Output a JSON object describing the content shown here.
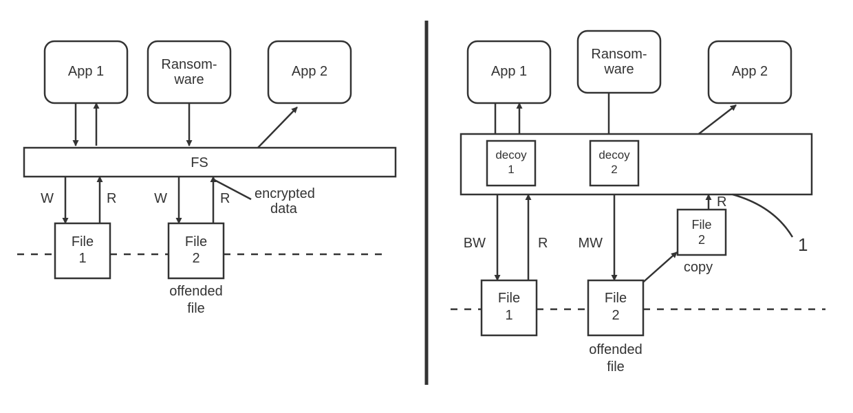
{
  "chart_data": {
    "type": "diagram",
    "title": "",
    "panels": [
      {
        "side": "left",
        "nodes": [
          {
            "id": "left-app1",
            "label": "App 1"
          },
          {
            "id": "left-ransomware",
            "label": "Ransom-\nware"
          },
          {
            "id": "left-app2",
            "label": "App 2"
          },
          {
            "id": "left-fs",
            "label": "FS"
          },
          {
            "id": "left-file1",
            "label": "File\n1"
          },
          {
            "id": "left-file2",
            "label": "File\n2"
          }
        ],
        "edges": [
          {
            "from": "left-app1",
            "to": "left-fs",
            "label": "",
            "dir": "both"
          },
          {
            "from": "left-ransomware",
            "to": "left-fs",
            "label": "",
            "dir": "one"
          },
          {
            "from": "left-fs",
            "to": "left-app2",
            "label": "",
            "dir": "one"
          },
          {
            "from": "left-fs",
            "to": "left-file1",
            "label": "W",
            "dir": "one"
          },
          {
            "from": "left-file1",
            "to": "left-fs",
            "label": "R",
            "dir": "one"
          },
          {
            "from": "left-fs",
            "to": "left-file2",
            "label": "W",
            "dir": "one"
          },
          {
            "from": "left-file2",
            "to": "left-fs",
            "label": "R",
            "dir": "one"
          }
        ],
        "annotations": [
          {
            "target": "left-file2",
            "text": "encrypted\ndata",
            "pos": "right"
          },
          {
            "target": "left-file2",
            "text": "offended\nfile",
            "pos": "below"
          }
        ]
      },
      {
        "side": "right",
        "nodes": [
          {
            "id": "right-app1",
            "label": "App 1"
          },
          {
            "id": "right-ransomware",
            "label": "Ransom-\nware"
          },
          {
            "id": "right-app2",
            "label": "App 2"
          },
          {
            "id": "right-fsbar",
            "label": ""
          },
          {
            "id": "right-decoy1",
            "label": "decoy\n1"
          },
          {
            "id": "right-decoy2",
            "label": "decoy\n2"
          },
          {
            "id": "right-file1",
            "label": "File\n1"
          },
          {
            "id": "right-file2",
            "label": "File\n2"
          },
          {
            "id": "right-file2copy",
            "label": "File\n2"
          }
        ],
        "edges": [
          {
            "from": "right-app1",
            "to": "right-decoy1",
            "label": "",
            "dir": "both"
          },
          {
            "from": "right-ransomware",
            "to": "right-decoy2",
            "label": "",
            "dir": "one"
          },
          {
            "from": "right-fsbar",
            "to": "right-app2",
            "label": "",
            "dir": "one"
          },
          {
            "from": "right-decoy1",
            "to": "right-file1",
            "label": "BW",
            "dir": "one"
          },
          {
            "from": "right-file1",
            "to": "right-decoy1",
            "label": "R",
            "dir": "one"
          },
          {
            "from": "right-decoy2",
            "to": "right-file2",
            "label": "MW",
            "dir": "one"
          },
          {
            "from": "right-file2copy",
            "to": "right-fsbar",
            "label": "R",
            "dir": "one"
          },
          {
            "from": "right-file2",
            "to": "right-file2copy",
            "label": "",
            "dir": "one"
          }
        ],
        "annotations": [
          {
            "target": "right-file2copy",
            "text": "copy",
            "pos": "below"
          },
          {
            "target": "right-file2",
            "text": "offended\nfile",
            "pos": "below"
          },
          {
            "target": "right-fsbar",
            "text": "1",
            "pos": "right-num"
          }
        ]
      }
    ]
  },
  "left": {
    "app1": "App 1",
    "ransom1": "Ransom-",
    "ransom2": "ware",
    "app2": "App 2",
    "fs": "FS",
    "file1a": "File",
    "file1b": "1",
    "file2a": "File",
    "file2b": "2",
    "W": "W",
    "R": "R",
    "enc1": "encrypted",
    "enc2": "data",
    "off1": "offended",
    "off2": "file"
  },
  "right": {
    "app1": "App 1",
    "ransom1": "Ransom-",
    "ransom2": "ware",
    "app2": "App 2",
    "decoy1a": "decoy",
    "decoy1b": "1",
    "decoy2a": "decoy",
    "decoy2b": "2",
    "file1a": "File",
    "file1b": "1",
    "file2a": "File",
    "file2b": "2",
    "fcopy1": "File",
    "fcopy2": "2",
    "BW": "BW",
    "R": "R",
    "MW": "MW",
    "copy": "copy",
    "off1": "offended",
    "off2": "file",
    "num": "1"
  }
}
